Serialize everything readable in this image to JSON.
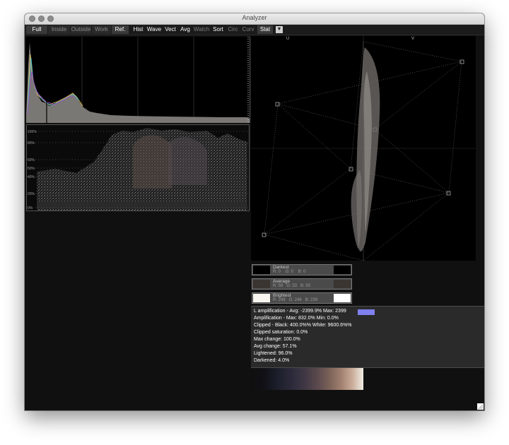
{
  "window": {
    "title": "Analyzer"
  },
  "toolbar": {
    "buttons": [
      {
        "label": "Full"
      },
      {
        "label": "Inside"
      },
      {
        "label": "Outside"
      },
      {
        "label": "Work"
      },
      {
        "label": "Ref."
      },
      {
        "label": "Hist"
      },
      {
        "label": "Wave"
      },
      {
        "label": "Vect"
      },
      {
        "label": "Avg"
      },
      {
        "label": "Watch"
      },
      {
        "label": "Sort"
      },
      {
        "label": "Circ"
      },
      {
        "label": "Curv"
      },
      {
        "label": "Stat"
      }
    ],
    "dropdown_icon": "triangle-down-icon"
  },
  "waveform": {
    "labels": [
      "100%",
      "80%",
      "60%",
      "50%",
      "40%",
      "20%",
      "0%"
    ]
  },
  "vectorscope": {
    "u_label": "U",
    "v_label": "V"
  },
  "swatches": {
    "darkest": {
      "label": "Darkest",
      "values": "R: 0    G: 0    B: 0",
      "color": "#000000"
    },
    "average": {
      "label": "Average",
      "values": "R: 59   G: 53   B: 50",
      "color": "#3b3532"
    },
    "brightest": {
      "label": "Brightest",
      "values": "R: 249   G: 246   B: 239",
      "color": "#f9f6ef"
    }
  },
  "stats": {
    "lines": [
      "L amplification - Avg: -2399.9%  Max: 2399",
      "Amplification - Max: 832.0%  Min: 0.0%",
      "Clipped - Black: 400.0%%  White: 9600.6%%",
      "Clipped saturation: 0.0%",
      "Max change: 100.0%",
      "Avg change: 57.1%",
      "Lightened: 96.0%",
      "Darkened: 4.0%"
    ],
    "avg_bar_color": "#8080f0"
  }
}
